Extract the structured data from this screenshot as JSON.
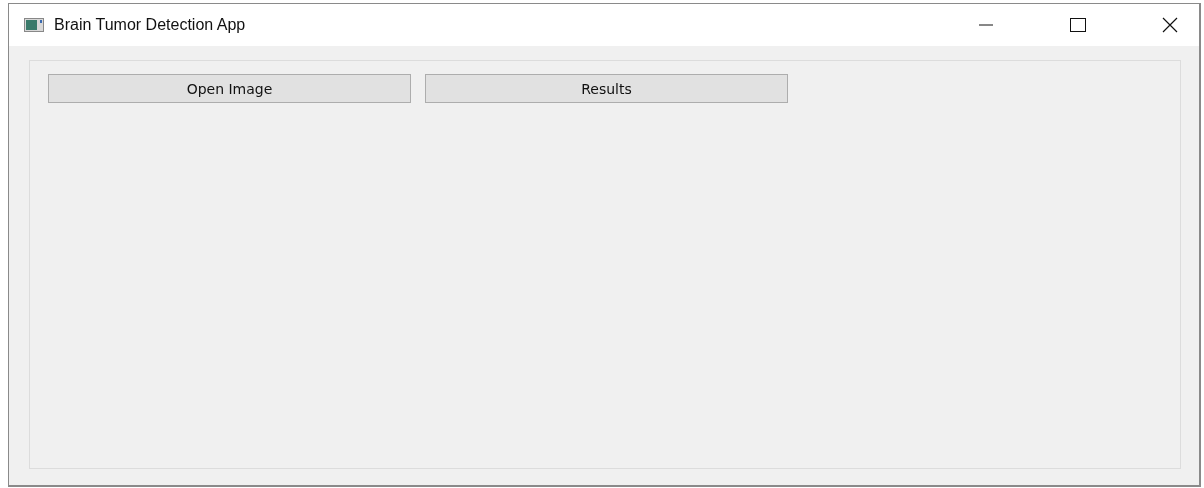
{
  "window": {
    "title": "Brain Tumor Detection App"
  },
  "buttons": [
    {
      "label": "Open Image"
    },
    {
      "label": "Results"
    }
  ]
}
